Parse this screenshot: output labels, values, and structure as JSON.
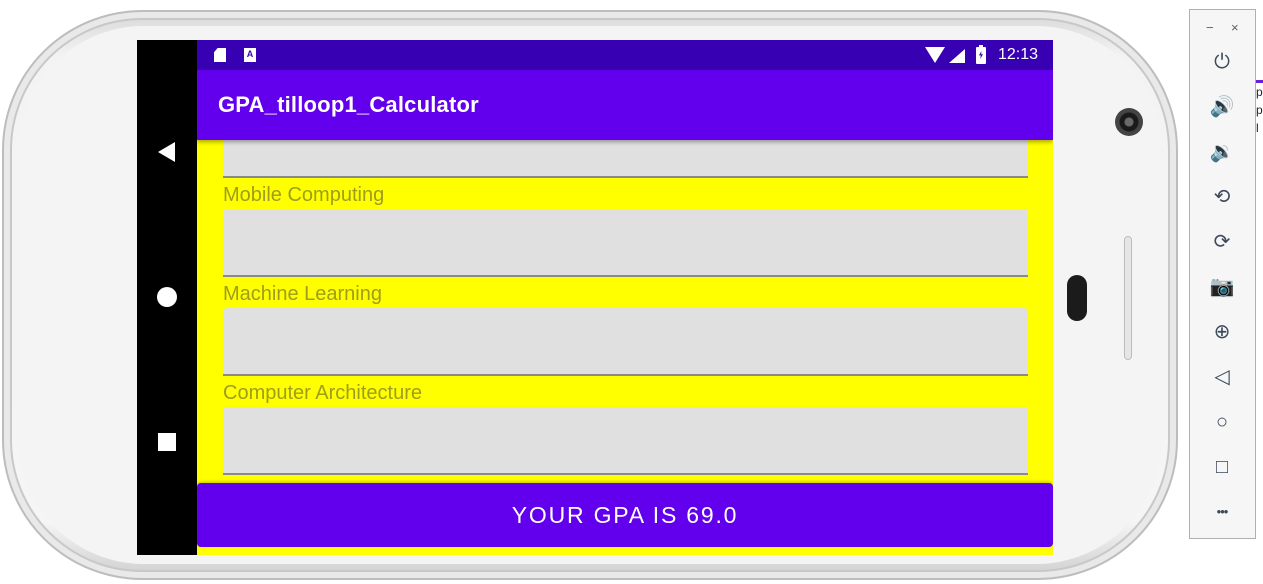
{
  "statusbar": {
    "time": "12:13",
    "icons": [
      "sd-card-icon",
      "a-notification-icon",
      "wifi-icon",
      "signal-icon",
      "battery-charging-icon"
    ]
  },
  "app": {
    "title": "GPA_tilloop1_Calculator"
  },
  "subjects": [
    {
      "label": "",
      "value": ""
    },
    {
      "label": "Mobile Computing",
      "value": ""
    },
    {
      "label": "Machine Learning",
      "value": ""
    },
    {
      "label": "Computer Architecture",
      "value": ""
    }
  ],
  "result_button": "YOUR GPA IS 69.0",
  "emulator_toolbar": {
    "minimize": "−",
    "close": "×",
    "buttons": [
      {
        "name": "power-icon",
        "glyph": "⏻"
      },
      {
        "name": "volume-up-icon",
        "glyph": "🔊"
      },
      {
        "name": "volume-down-icon",
        "glyph": "🔉"
      },
      {
        "name": "rotate-left-icon",
        "glyph": "⟲"
      },
      {
        "name": "rotate-right-icon",
        "glyph": "⟳"
      },
      {
        "name": "camera-icon",
        "glyph": "📷"
      },
      {
        "name": "zoom-icon",
        "glyph": "⊕"
      },
      {
        "name": "back-icon",
        "glyph": "◁"
      },
      {
        "name": "home-icon",
        "glyph": "○"
      },
      {
        "name": "overview-icon",
        "glyph": "□"
      },
      {
        "name": "more-icon",
        "glyph": "•••"
      }
    ]
  },
  "host_window_text": "p\np\nl",
  "colors": {
    "primary": "#6200ee",
    "primary_dark": "#3700b3",
    "background": "#ffff00",
    "field": "#e0e0e0",
    "label": "#9e9e1a"
  }
}
